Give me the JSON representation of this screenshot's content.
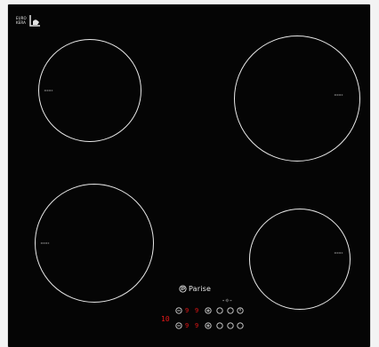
{
  "image": {
    "subject": "black glass induction hob with four cooking zones and a touch control panel",
    "background_color": "#f3f3f3",
    "glass_color": "#050505",
    "line_color": "#e9e9e9",
    "display_color": "#e81818"
  },
  "logo": {
    "text": "EUROKERA",
    "icon": "eurokera-pan-icon"
  },
  "brand": {
    "name": "Parise",
    "icon": "parise-logo-icon"
  },
  "cooking_zones": [
    {
      "name": "front-left",
      "position": "top-left"
    },
    {
      "name": "rear-right",
      "position": "top-right"
    },
    {
      "name": "bottom-left",
      "position": "bottom-left"
    },
    {
      "name": "bottom-right",
      "position": "bottom-right"
    }
  ],
  "control_panel": {
    "timer_readout": "10",
    "zone_readouts_top": [
      "9",
      "9"
    ],
    "zone_readouts_bottom": [
      "9",
      "9"
    ],
    "lock_label": "-☼-",
    "button_icons": [
      "minus-icon",
      "plus-icon",
      "timer-icon",
      "lock-icon",
      "power-icon"
    ]
  }
}
